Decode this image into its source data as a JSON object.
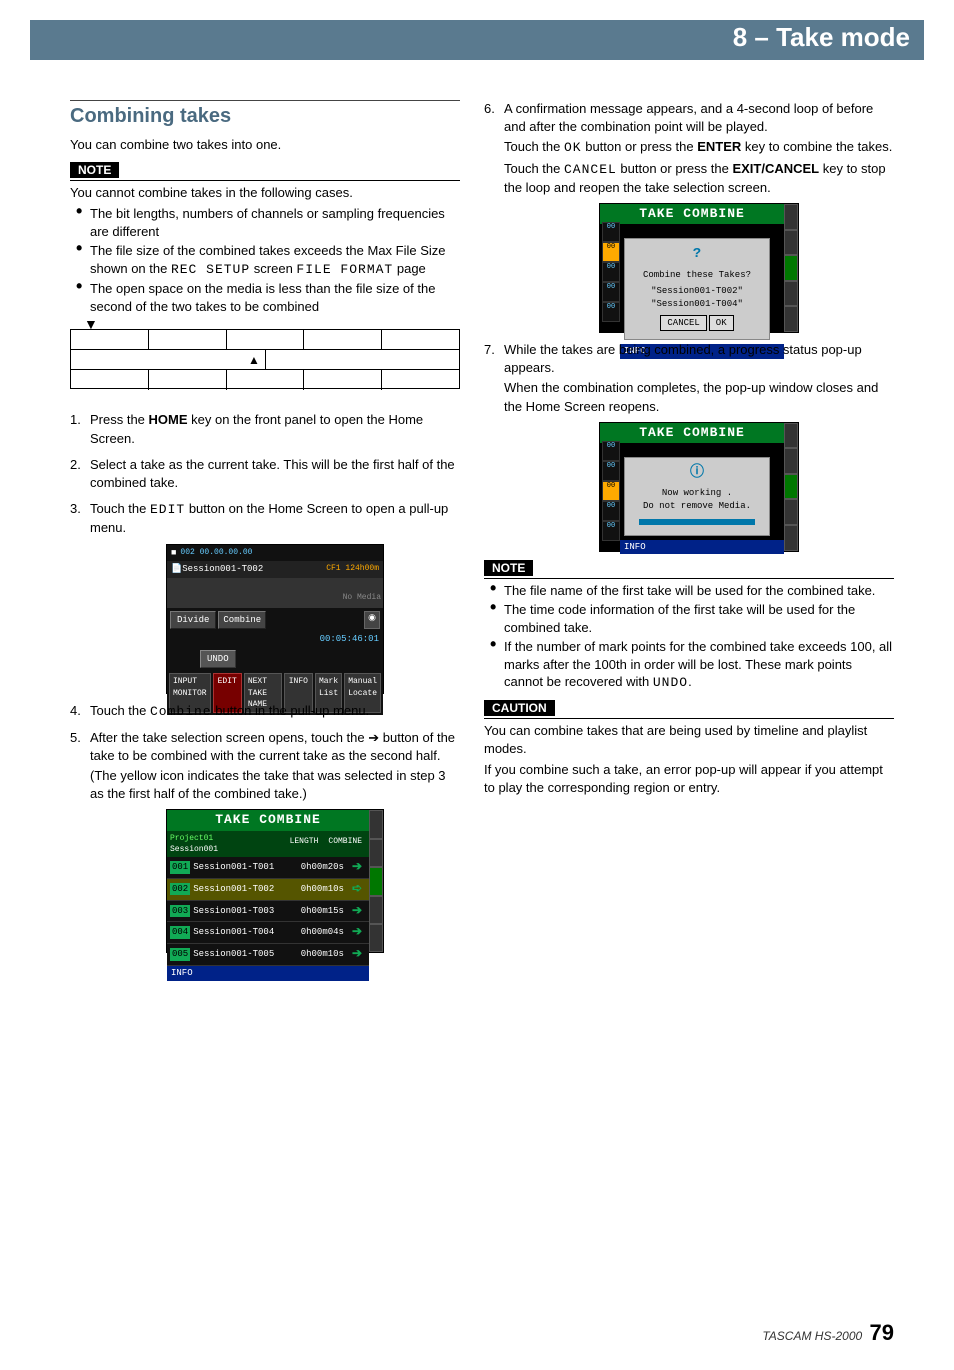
{
  "chapter": "8 – Take mode",
  "section_title": "Combining takes",
  "intro": "You can combine two takes into one.",
  "note1_label": "NOTE",
  "note1_lead": "You cannot combine takes in the following cases.",
  "note1_bullets": [
    {
      "pre": "The bit lengths, numbers of channels or sampling frequencies are different"
    },
    {
      "pre": "The file size of the combined takes exceeds the Max File Size shown on the ",
      "mono1": "REC SETUP",
      "mid": " screen ",
      "mono2": "FILE FORMAT",
      "post": " page"
    },
    {
      "pre": "The open space on the media is less than the file size of the second of the two takes to be combined"
    }
  ],
  "steps": {
    "s1": {
      "a": "Press the ",
      "b": "HOME",
      "c": " key on the front panel to open the Home Screen."
    },
    "s2": "Select a take as the current take. This will be the first half of the combined take.",
    "s3": {
      "a": "Touch the ",
      "mono": "EDIT",
      "b": " button on the Home Screen to open a pull-up menu."
    },
    "s4": {
      "a": "Touch the ",
      "mono": "Combine",
      "b": " button in the pull-up menu."
    },
    "s5": {
      "a": "After the take selection screen opens, touch the ",
      "arrow": "➔",
      "b": " button of the take to be combined with the current take as the second half.",
      "c": "(The yellow icon indicates the take that was selected in step 3 as the first half of the combined take.)"
    },
    "s6": {
      "a": "A confirmation message appears, and a 4-second loop of before and after the combination point will be played.",
      "b1": "Touch the ",
      "mono1": "OK",
      "b2": " button or press the ",
      "bold1": "ENTER",
      "b3": " key to combine the takes.",
      "c1": "Touch the ",
      "mono2": "CANCEL",
      "c2": " button or press the ",
      "bold2": "EXIT/CANCEL",
      "c3": " key to stop the loop and reopen the take selection screen."
    },
    "s7": {
      "a": "While the takes are being combined, a progress status pop-up appears.",
      "b": "When the combination completes, the pop-up window closes and the Home Screen reopens."
    }
  },
  "shotA": {
    "session": "Session001-T002",
    "cf": "CF1 124h00m",
    "nomedia": "No Media",
    "divide": "Divide",
    "combine": "Combine",
    "undo": "UNDO",
    "edit": "EDIT",
    "next": "NEXT TAKE NAME",
    "info": "INFO",
    "mark": "Mark List",
    "manual": "Manual Locate",
    "inpmon": "INPUT MONITOR",
    "time": "00:05:46:01",
    "counter": "002 00.00.00.00"
  },
  "shotB": {
    "title": "TAKE COMBINE",
    "proj": "Project01",
    "sess": "Session001",
    "hlen": "LENGTH",
    "hcmb": "COMBINE",
    "rows": [
      {
        "n": "001",
        "name": "Session001-T001",
        "len": "0h00m20s"
      },
      {
        "n": "002",
        "name": "Session001-T002",
        "len": "0h00m10s"
      },
      {
        "n": "003",
        "name": "Session001-T003",
        "len": "0h00m15s"
      },
      {
        "n": "004",
        "name": "Session001-T004",
        "len": "0h00m04s"
      },
      {
        "n": "005",
        "name": "Session001-T005",
        "len": "0h00m10s"
      }
    ],
    "info": "INFO"
  },
  "shotC": {
    "title": "TAKE COMBINE",
    "msg": "Combine these Takes?",
    "l1": "\"Session001-T002\"",
    "l2": "\"Session001-T004\"",
    "cancel": "CANCEL",
    "ok": "OK",
    "info": "INFO"
  },
  "shotD": {
    "title": "TAKE COMBINE",
    "l1": "Now working .",
    "l2": "Do not remove Media.",
    "info": "INFO"
  },
  "note2_label": "NOTE",
  "note2_bullets": [
    "The file name of the first take will be used for the combined take.",
    "The time code information of the first take will be used for the combined take."
  ],
  "note2_bullet3": {
    "a": "If the number of mark points for the combined take exceeds 100, all marks after the 100th in order will be lost. These mark points cannot be recovered with ",
    "mono": "UNDO",
    "b": "."
  },
  "caution_label": "CAUTION",
  "caution_p1": "You can combine takes that are being used by timeline and playlist modes.",
  "caution_p2": "If you combine such a take, an error pop-up will appear if you attempt to play the corresponding region or entry.",
  "footer_model": "TASCAM HS-2000",
  "footer_page": "79"
}
